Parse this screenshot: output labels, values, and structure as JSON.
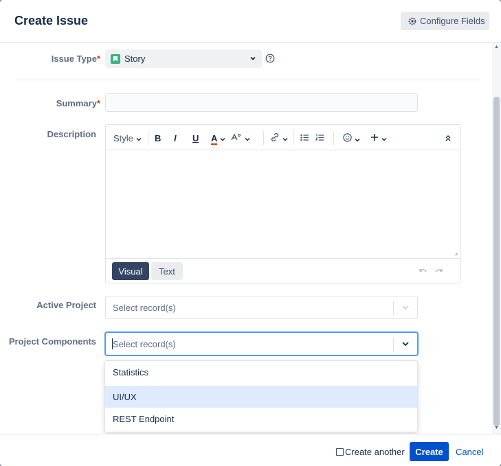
{
  "dialog": {
    "title": "Create Issue",
    "configure_fields_label": "Configure Fields"
  },
  "fields": {
    "issue_type": {
      "label": "Issue Type",
      "required_mark": "*",
      "value": "Story"
    },
    "summary": {
      "label": "Summary",
      "required_mark": "*",
      "value": ""
    },
    "description": {
      "label": "Description",
      "toolbar": {
        "style_label": "Style",
        "bold": "B",
        "italic": "I",
        "underline": "U",
        "text_color": "A"
      },
      "modes": {
        "visual": "Visual",
        "text": "Text"
      },
      "active_mode": "Visual"
    },
    "active_project": {
      "label": "Active Project",
      "placeholder": "Select record(s)"
    },
    "project_components": {
      "label": "Project Components",
      "placeholder": "Select record(s)",
      "options": [
        "Statistics",
        "UI/UX",
        "REST Endpoint"
      ],
      "highlighted_option": "UI/UX"
    }
  },
  "footer": {
    "create_another_label": "Create another",
    "create_another_checked": false,
    "create_label": "Create",
    "cancel_label": "Cancel"
  },
  "colors": {
    "primary": "#0052cc",
    "story": "#36b37e",
    "required": "#de350b",
    "focus": "#4c9aff",
    "highlight": "#deebff"
  },
  "icons": [
    "gear-icon",
    "story-icon",
    "chevron-down-icon",
    "help-icon",
    "link-icon",
    "bullet-list-icon",
    "numbered-list-icon",
    "emoji-icon",
    "plus-icon",
    "collapse-icon",
    "undo-icon",
    "redo-icon"
  ]
}
